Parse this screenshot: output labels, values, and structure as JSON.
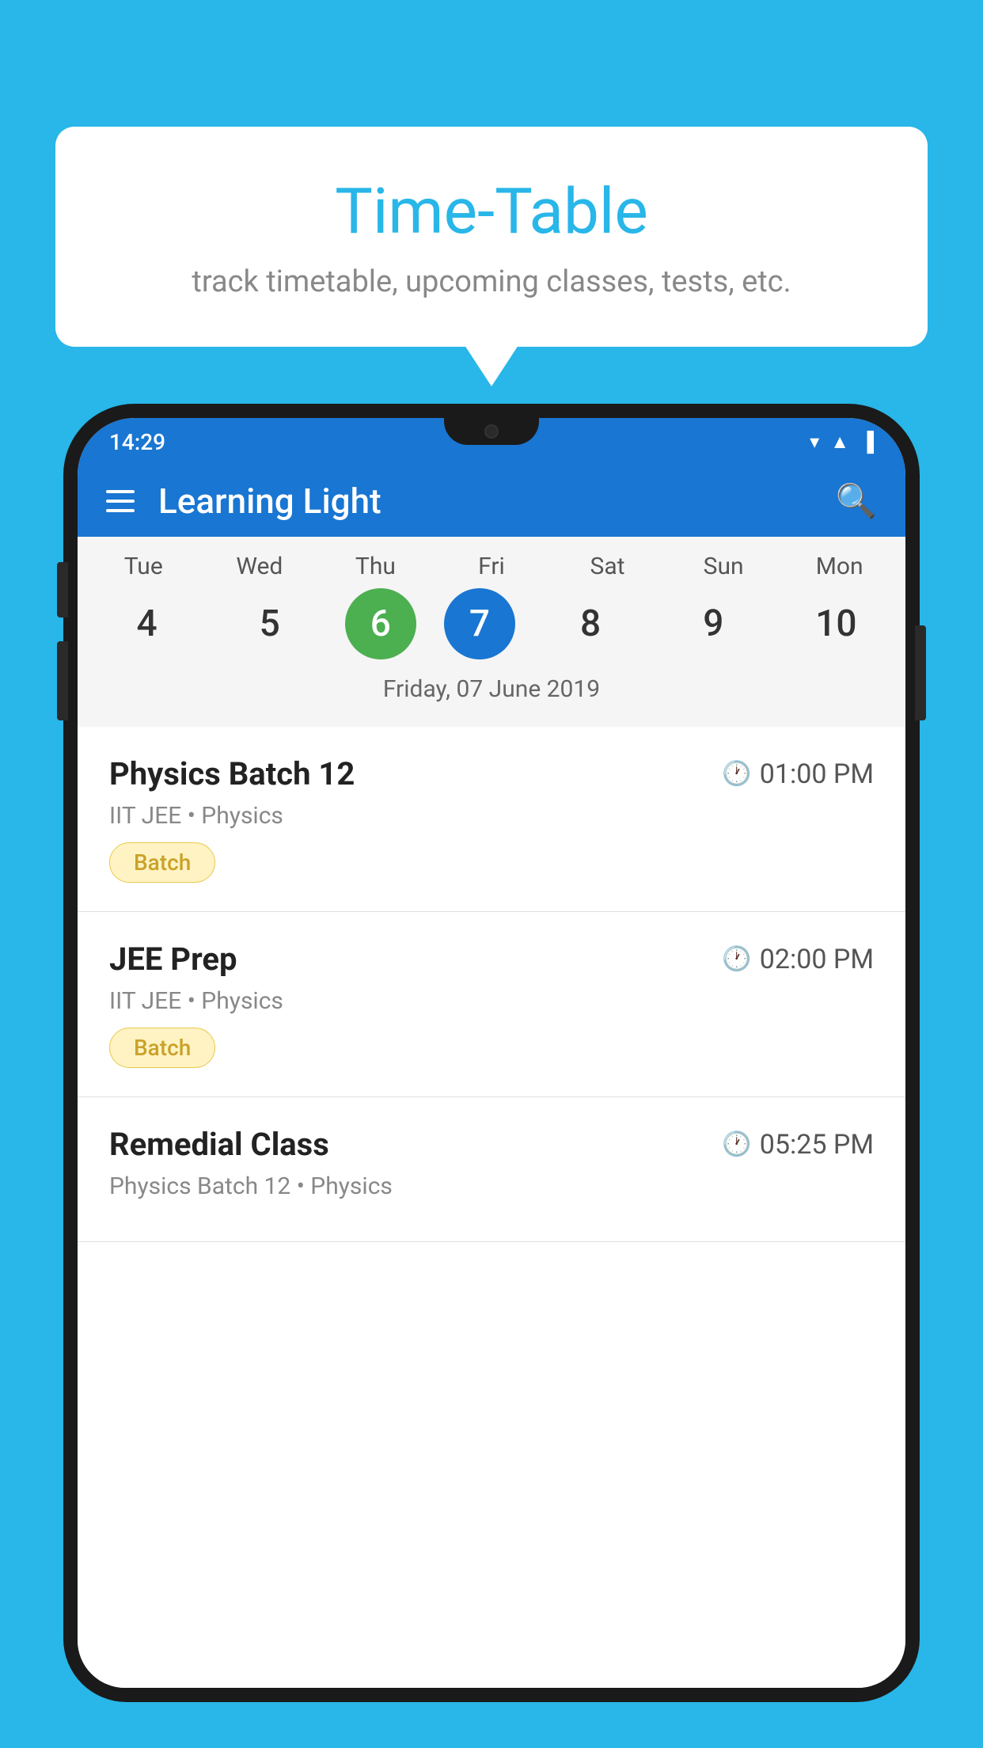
{
  "background_color": "#29b6e8",
  "bubble": {
    "title": "Time-Table",
    "subtitle": "track timetable, upcoming classes, tests, etc."
  },
  "phone": {
    "status": {
      "time": "14:29",
      "signal_icon": "▲",
      "wifi_icon": "▾"
    },
    "app_bar": {
      "title": "Learning Light",
      "search_label": "search"
    },
    "calendar": {
      "days": [
        {
          "name": "Tue",
          "number": "4",
          "state": "normal"
        },
        {
          "name": "Wed",
          "number": "5",
          "state": "normal"
        },
        {
          "name": "Thu",
          "number": "6",
          "state": "today"
        },
        {
          "name": "Fri",
          "number": "7",
          "state": "selected"
        },
        {
          "name": "Sat",
          "number": "8",
          "state": "normal"
        },
        {
          "name": "Sun",
          "number": "9",
          "state": "normal"
        },
        {
          "name": "Mon",
          "number": "10",
          "state": "normal"
        }
      ],
      "selected_date": "Friday, 07 June 2019"
    },
    "classes": [
      {
        "name": "Physics Batch 12",
        "time": "01:00 PM",
        "meta": "IIT JEE • Physics",
        "tag": "Batch"
      },
      {
        "name": "JEE Prep",
        "time": "02:00 PM",
        "meta": "IIT JEE • Physics",
        "tag": "Batch"
      },
      {
        "name": "Remedial Class",
        "time": "05:25 PM",
        "meta": "Physics Batch 12 • Physics",
        "tag": null
      }
    ]
  }
}
